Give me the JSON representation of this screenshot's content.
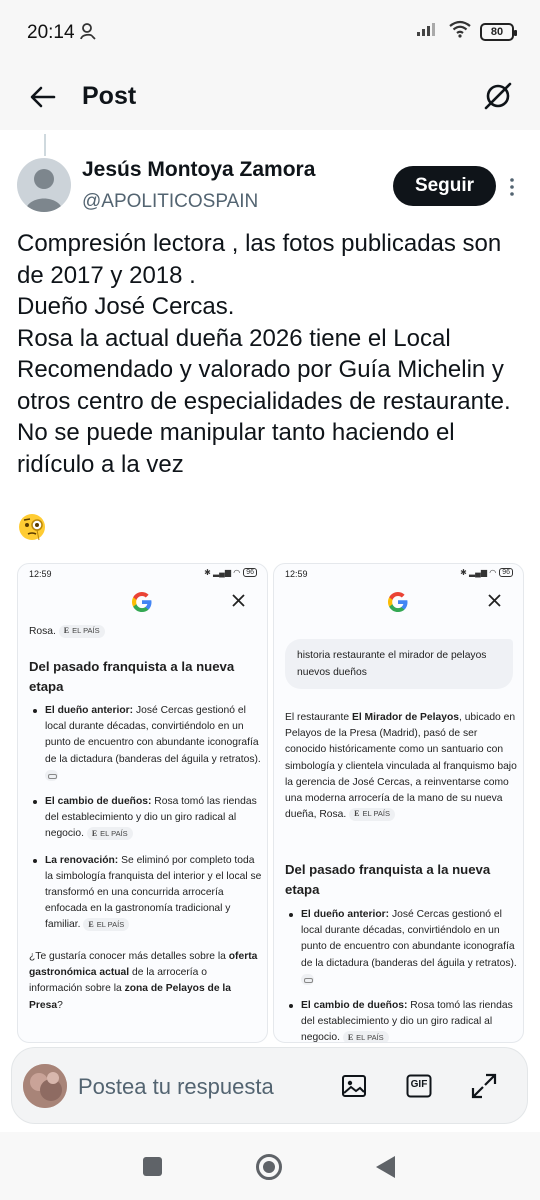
{
  "status_bar": {
    "time": "20:14",
    "battery": "80"
  },
  "header": {
    "title": "Post"
  },
  "author": {
    "name": "Jesús Montoya Zamora",
    "handle": "@APOLITICOSPAIN",
    "follow_label": "Seguir"
  },
  "tweet": {
    "text": "Compresión lectora , las fotos publicadas son de 2017 y 2018 .\nDueño José Cercas.\nRosa la actual dueña 2026 tiene el Local Recomendado y valorado por Guía Michelin y otros centro de especialidades de restaurante.\nNo se puede manipular tanto haciendo el ridículo a la vez",
    "emoji": "face-with-monocle"
  },
  "screenshots": [
    {
      "time": "12:59",
      "battery": "96",
      "top_fragment": "Rosa.",
      "source": "EL PAÍS",
      "heading": "Del pasado franquista a la nueva etapa",
      "bullets": [
        {
          "bold": "El dueño anterior:",
          "text": " José Cercas gestionó el local durante décadas, convirtiéndolo en un punto de encuentro con abundante iconografía de la dictadura (banderas del águila y retratos)."
        },
        {
          "bold": "El cambio de dueños:",
          "text": " Rosa tomó las riendas del establecimiento y dio un giro radical al negocio."
        },
        {
          "bold": "La renovación:",
          "text": " Se eliminó por completo toda la simbología franquista del interior y el local se transformó en una concurrida arrocería enfocada en la gastronomía tradicional y familiar."
        }
      ],
      "footer_1": "¿Te gustaría conocer más detalles sobre la ",
      "footer_bold_1": "oferta gastronómica actual",
      "footer_2": " de la arrocería o información sobre la ",
      "footer_bold_2": "zona de Pelayos de la Presa",
      "footer_3": "?"
    },
    {
      "time": "12:59",
      "battery": "96",
      "query": "historia restaurante el mirador de pelayos nuevos dueños",
      "intro_1": "El restaurante ",
      "intro_bold": "El Mirador de Pelayos",
      "intro_2": ", ubicado en Pelayos de la Presa (Madrid), pasó de ser conocido históricamente como un santuario con simbología y clientela vinculada al franquismo bajo la gerencia de José Cercas, a reinventarse como una moderna arrocería de la mano de su nueva dueña, Rosa.",
      "source": "EL PAÍS",
      "heading": "Del pasado franquista a la nueva etapa",
      "bullets": [
        {
          "bold": "El dueño anterior:",
          "text": " José Cercas gestionó el local durante décadas, convirtiéndolo en un punto de encuentro con abundante iconografía de la dictadura (banderas del águila y retratos)."
        },
        {
          "bold": "El cambio de dueños:",
          "text": " Rosa tomó las riendas del establecimiento y dio un giro radical al negocio."
        }
      ]
    }
  ],
  "reply_bar": {
    "placeholder": "Postea tu respuesta",
    "gif_label": "GIF"
  }
}
